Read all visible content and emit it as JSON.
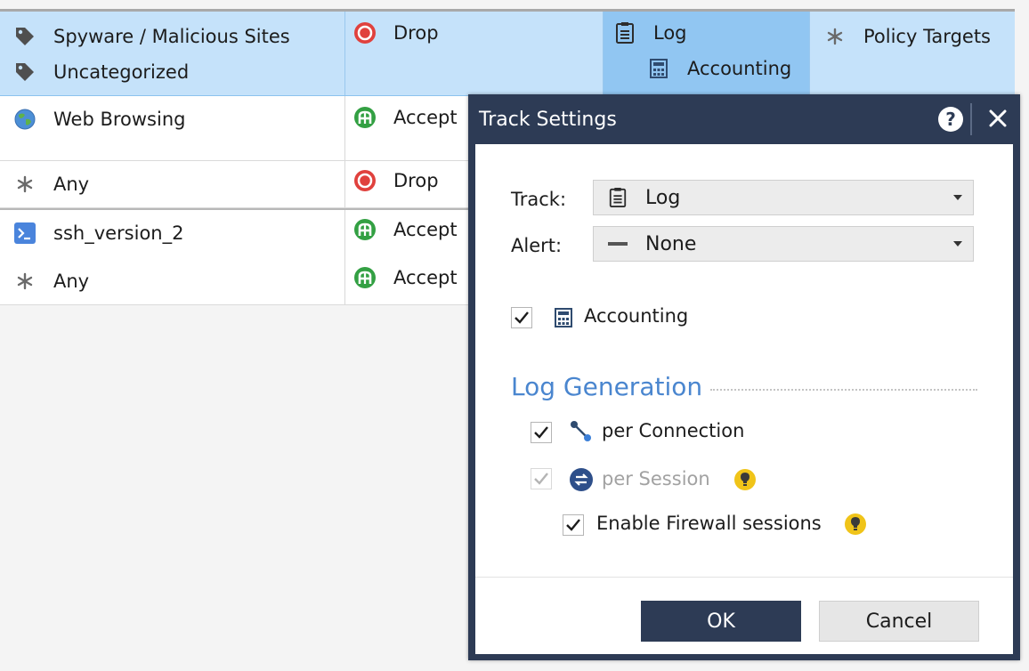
{
  "table": {
    "rows": [
      {
        "services": [
          {
            "icon": "tag-icon",
            "label": "Spyware / Malicious Sites"
          },
          {
            "icon": "tag-icon",
            "label": "Uncategorized"
          }
        ],
        "action": {
          "icon": "drop-icon",
          "label": "Drop"
        },
        "track": [
          {
            "icon": "log-icon",
            "label": "Log"
          },
          {
            "icon": "accounting-icon",
            "label": "Accounting"
          }
        ],
        "install_on": {
          "icon": "asterisk-icon",
          "label": "Policy Targets"
        }
      },
      {
        "services": [
          {
            "icon": "globe-icon",
            "label": "Web Browsing"
          }
        ],
        "action": {
          "icon": "accept-icon",
          "label": "Accept"
        }
      },
      {
        "services": [
          {
            "icon": "asterisk-icon",
            "label": "Any"
          }
        ],
        "action": {
          "icon": "drop-icon",
          "label": "Drop"
        }
      },
      {
        "services": [
          {
            "icon": "terminal-icon",
            "label": "ssh_version_2"
          }
        ],
        "action": {
          "icon": "accept-icon",
          "label": "Accept"
        }
      },
      {
        "services": [
          {
            "icon": "asterisk-icon",
            "label": "Any"
          }
        ],
        "action": {
          "icon": "accept-icon",
          "label": "Accept"
        }
      }
    ]
  },
  "dialog": {
    "title": "Track Settings",
    "help_icon": "help-icon",
    "close_icon": "close-icon",
    "track": {
      "label": "Track:",
      "value": "Log",
      "icon": "log-icon"
    },
    "alert": {
      "label": "Alert:",
      "value": "None",
      "icon": "dash-icon"
    },
    "accounting": {
      "label": "Accounting",
      "checked": true,
      "icon": "accounting-icon"
    },
    "log_generation": {
      "title": "Log Generation",
      "per_connection": {
        "label": "per Connection",
        "checked": true,
        "icon": "connection-icon"
      },
      "per_session": {
        "label": "per Session",
        "checked": true,
        "disabled": true,
        "icon": "session-icon"
      },
      "enable_firewall_sessions": {
        "label": "Enable Firewall sessions",
        "checked": true
      }
    },
    "ok_label": "OK",
    "cancel_label": "Cancel"
  },
  "colors": {
    "dialog_frame": "#2d3b55",
    "selected_row": "#c5e2fa",
    "active_cell": "#91c6f2",
    "section_title": "#4a86cf",
    "drop": "#e0413d",
    "accept": "#33a043",
    "tip_bulb": "#f0c419"
  }
}
